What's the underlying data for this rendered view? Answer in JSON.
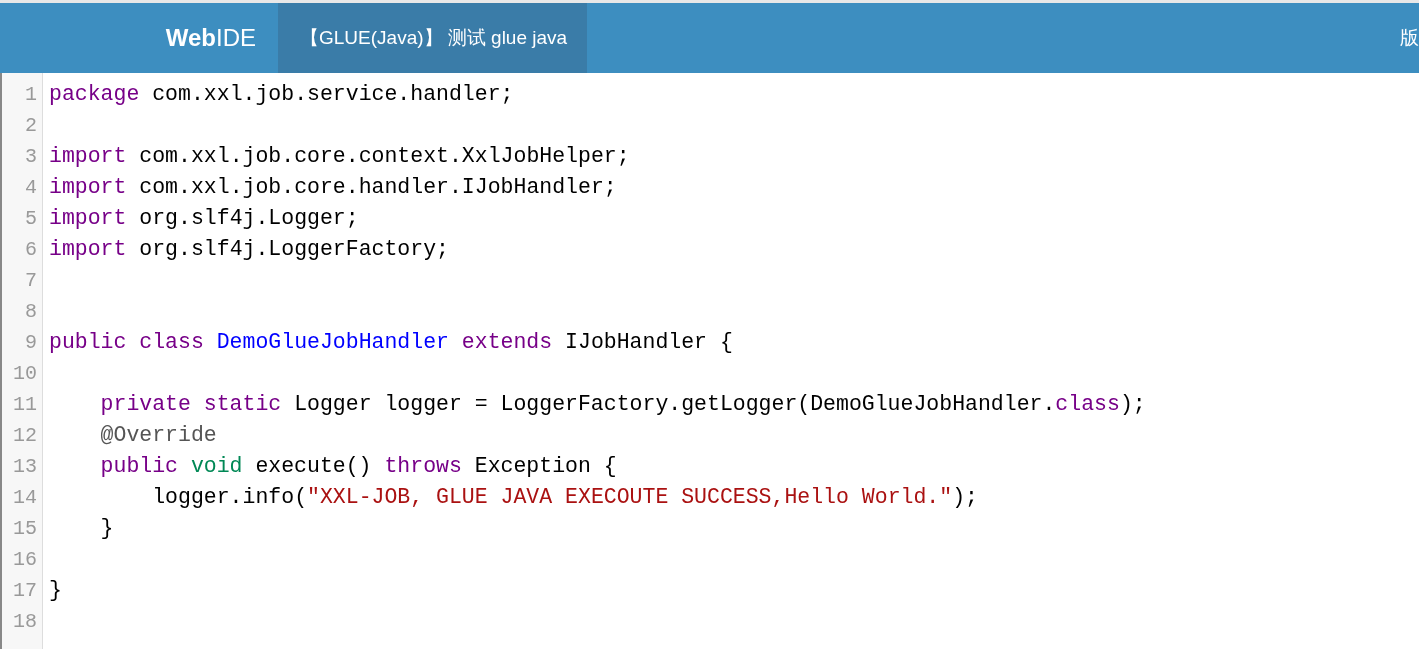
{
  "header": {
    "brand": "**Web**IDE",
    "tabs": [
      {
        "label": "【GLUE(Java)】 测试 glue java",
        "selected": true
      }
    ],
    "right_text": "版"
  },
  "editor": {
    "lines": [
      {
        "number": "1",
        "tokens": [
          {
            "text": "package",
            "kind": "keyword"
          },
          {
            "text": "com.xxl.job.service.handler;",
            "kind": "plain",
            "space_before": true
          }
        ]
      },
      {
        "number": "2"
      },
      {
        "number": "3",
        "tokens": [
          {
            "text": "import",
            "kind": "keyword"
          },
          {
            "text": "com.xxl.job.core.context.XxlJobHelper;",
            "kind": "plain",
            "space_before": true
          }
        ]
      },
      {
        "number": "4",
        "tokens": [
          {
            "text": "import",
            "kind": "keyword"
          },
          {
            "text": "com.xxl.job.core.handler.IJobHandler;",
            "kind": "plain",
            "space_before": true
          }
        ]
      },
      {
        "number": "5",
        "tokens": [
          {
            "text": "import",
            "kind": "keyword"
          },
          {
            "text": "org.slf4j.Logger;",
            "kind": "plain",
            "space_before": true
          }
        ]
      },
      {
        "number": "6",
        "tokens": [
          {
            "text": "import",
            "kind": "keyword"
          },
          {
            "text": "org.slf4j.LoggerFactory;",
            "kind": "plain",
            "space_before": true
          }
        ]
      },
      {
        "number": "7"
      },
      {
        "number": "8"
      },
      {
        "number": "9",
        "tokens": [
          {
            "text": "public",
            "kind": "keyword"
          },
          {
            "text": "class",
            "kind": "keyword",
            "space_before": true
          },
          {
            "text": "DemoGlueJobHandler",
            "kind": "def",
            "space_before": true
          },
          {
            "text": "extends",
            "kind": "keyword",
            "space_before": true
          },
          {
            "text": "IJobHandler {",
            "kind": "plain",
            "space_before": true
          }
        ]
      },
      {
        "number": "10"
      },
      {
        "number": "11",
        "indent": true,
        "tokens": [
          {
            "text": "private",
            "kind": "keyword"
          },
          {
            "text": "static",
            "kind": "keyword",
            "space_before": true
          },
          {
            "text": "Logger logger = LoggerFactory.getLogger(DemoGlueJobHandler.",
            "kind": "plain",
            "space_before": true
          },
          {
            "text": "class",
            "kind": "keyword"
          },
          {
            "text": ");",
            "kind": "plain"
          }
        ]
      },
      {
        "number": "12",
        "indent": true,
        "tokens": [
          {
            "text": "@Override",
            "kind": "meta"
          }
        ]
      },
      {
        "number": "13",
        "indent": true,
        "tokens": [
          {
            "text": "public",
            "kind": "keyword"
          },
          {
            "text": "void",
            "kind": "type",
            "space_before": true
          },
          {
            "text": "execute()",
            "kind": "plain",
            "space_before": true
          },
          {
            "text": "throws",
            "kind": "keyword",
            "space_before": true
          },
          {
            "text": "Exception {",
            "kind": "plain",
            "space_before": true
          }
        ]
      },
      {
        "number": "14",
        "indent": true,
        "tokens": [
          {
            "text": "    logger.info(",
            "kind": "plain"
          },
          {
            "text": "\"XXL-JOB, GLUE JAVA EXECOUTE SUCCESS,Hello World.\"",
            "kind": "string"
          },
          {
            "text": ");",
            "kind": "plain"
          }
        ]
      },
      {
        "number": "15",
        "indent": true,
        "tokens": [
          {
            "text": "}",
            "kind": "plain"
          }
        ]
      },
      {
        "number": "16"
      },
      {
        "number": "17",
        "tokens": [
          {
            "text": "}",
            "kind": "plain"
          }
        ]
      },
      {
        "number": "18"
      }
    ]
  }
}
